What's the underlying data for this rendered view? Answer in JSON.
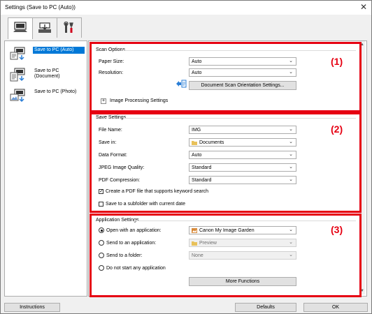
{
  "window": {
    "title": "Settings (Save to PC (Auto))"
  },
  "tabs": [
    {
      "name": "Scan from a Computer",
      "icon": "computer-icon"
    },
    {
      "name": "Scan from the Operation Panel",
      "icon": "scanner-icon"
    },
    {
      "name": "General Settings",
      "icon": "tools-icon"
    }
  ],
  "left_panel": {
    "items": [
      {
        "label": "Save to PC (Auto)",
        "icon": "save-auto-icon",
        "selected": true
      },
      {
        "label": "Save to PC (Document)",
        "icon": "save-document-icon",
        "selected": false
      },
      {
        "label": "Save to PC (Photo)",
        "icon": "save-photo-icon",
        "selected": false
      }
    ]
  },
  "scan_options": {
    "title": "Scan Options",
    "number": "(1)",
    "paper_size_label": "Paper Size:",
    "paper_size_value": "Auto",
    "resolution_label": "Resolution:",
    "resolution_value": "Auto",
    "orientation_button": "Document Scan Orientation Settings...",
    "image_processing": "Image Processing Settings",
    "expand_symbol": "+"
  },
  "save_settings": {
    "title": "Save Settings",
    "number": "(2)",
    "file_name_label": "File Name:",
    "file_name_value": "IMG",
    "save_in_label": "Save in:",
    "save_in_value": "Documents",
    "data_format_label": "Data Format:",
    "data_format_value": "Auto",
    "jpeg_quality_label": "JPEG Image Quality:",
    "jpeg_quality_value": "Standard",
    "pdf_compression_label": "PDF Compression:",
    "pdf_compression_value": "Standard",
    "keyword_pdf_label": "Create a PDF file that supports keyword search",
    "keyword_pdf_checked": true,
    "subfolder_label": "Save to a subfolder with current date",
    "subfolder_checked": false
  },
  "app_settings": {
    "title": "Application Settings",
    "number": "(3)",
    "open_with_label": "Open with an application:",
    "open_with_value": "Canon My Image Garden",
    "send_app_label": "Send to an application:",
    "send_app_value": "Preview",
    "send_folder_label": "Send to a folder:",
    "send_folder_value": "None",
    "no_app_label": "Do not start any application",
    "selected_option": "Open with an application:",
    "more_functions_button": "More Functions"
  },
  "footer": {
    "instructions": "Instructions",
    "defaults": "Defaults",
    "ok": "OK"
  },
  "colors": {
    "accent": "#e60012",
    "selection": "#0078d7"
  }
}
